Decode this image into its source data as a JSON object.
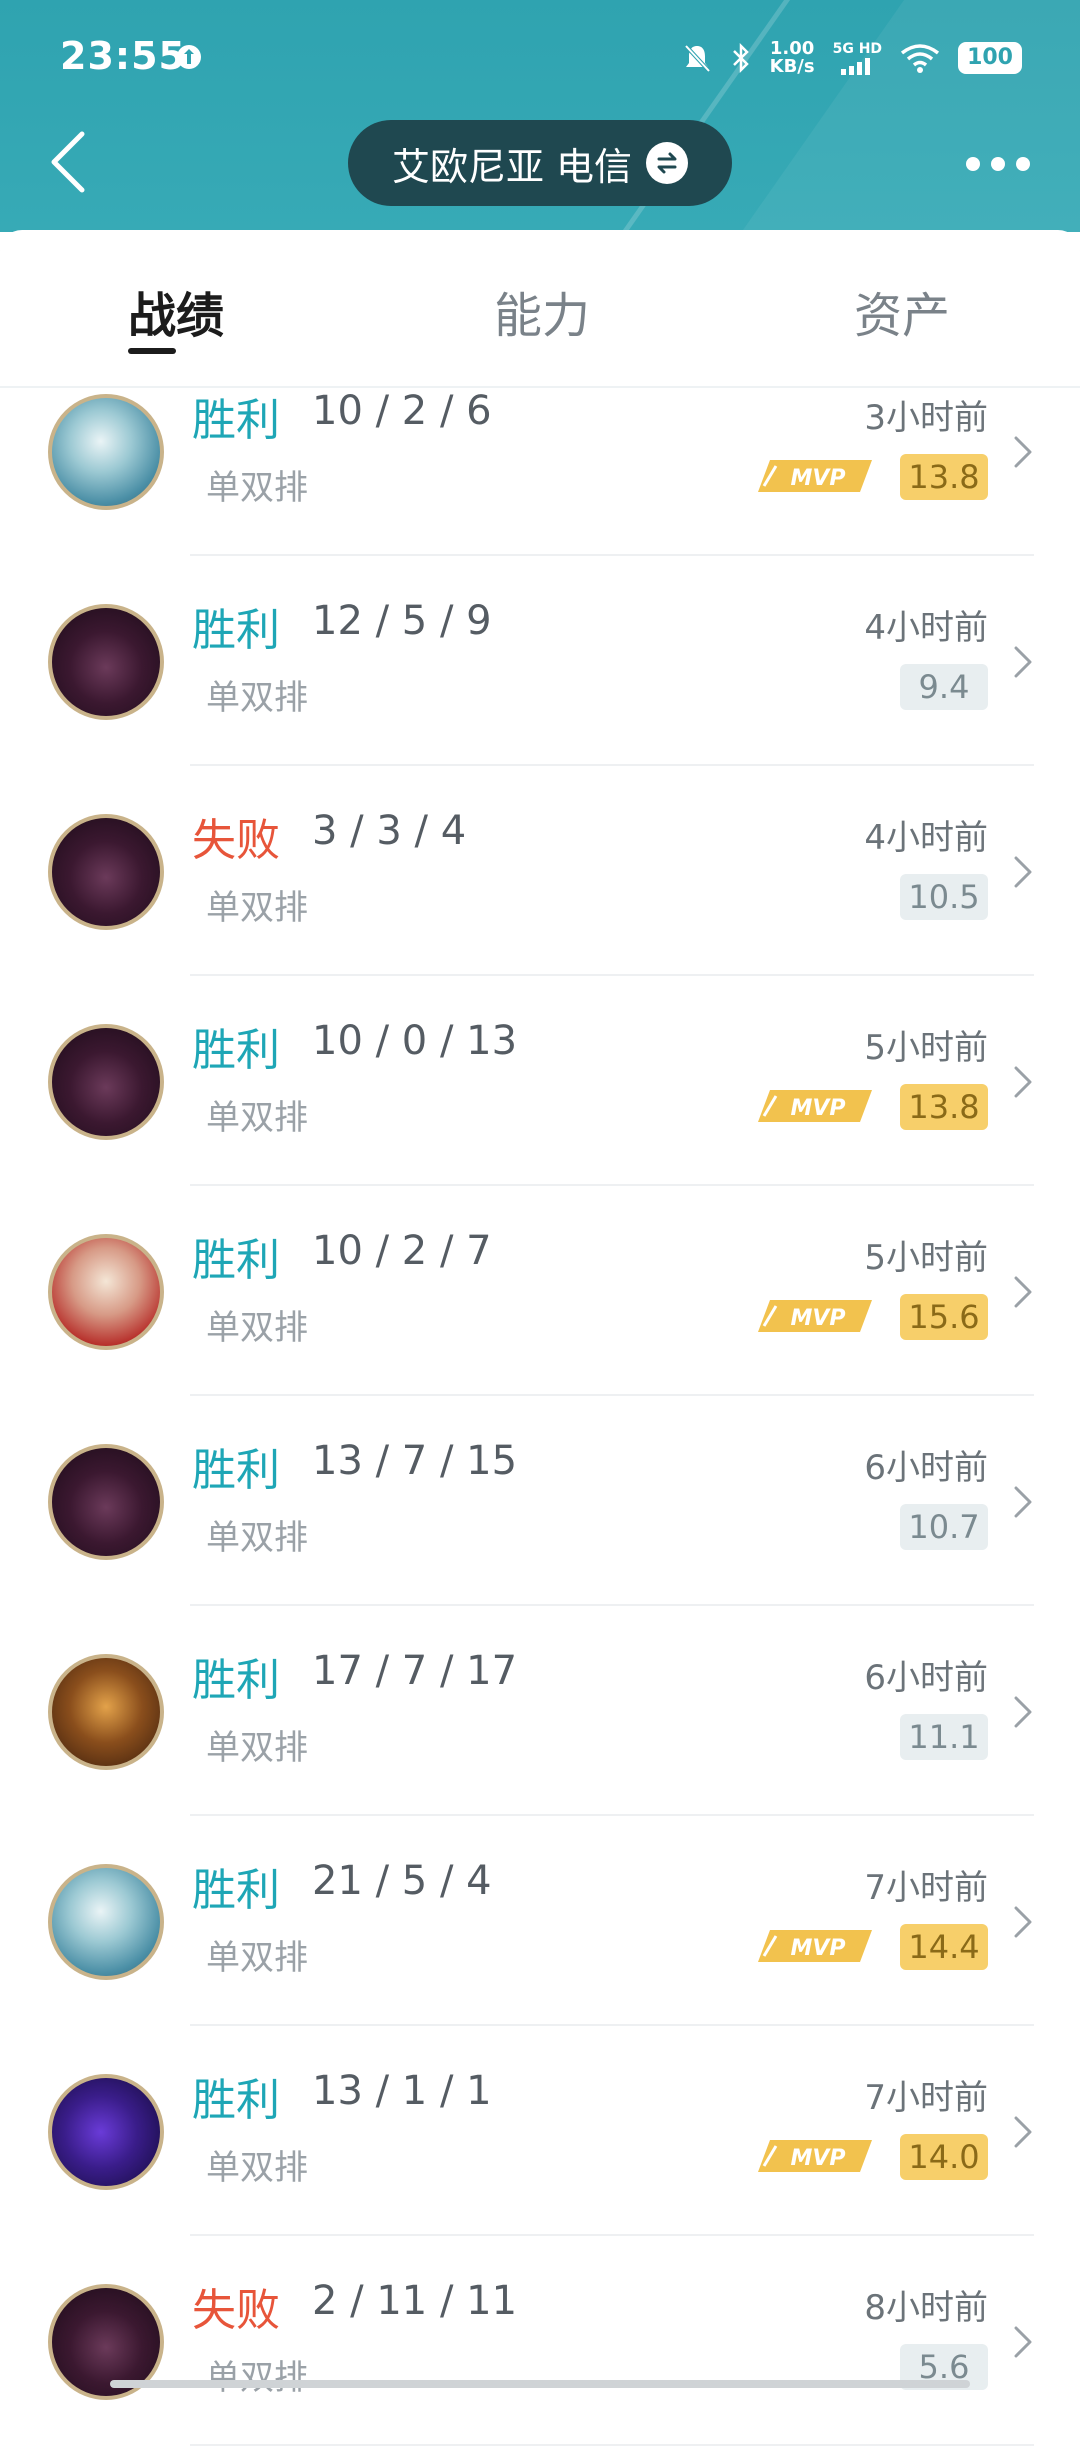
{
  "status_bar": {
    "time": "23:55",
    "net_speed": "1.00",
    "net_unit": "KB/s",
    "network": "5G HD",
    "battery": "100"
  },
  "header": {
    "server": "艾欧尼亚 电信"
  },
  "tabs": [
    {
      "label": "战绩",
      "active": true
    },
    {
      "label": "能力",
      "active": false
    },
    {
      "label": "资产",
      "active": false
    }
  ],
  "matches": [
    {
      "result": "胜利",
      "outcome": "win",
      "kda": "10 / 2 / 6",
      "queue": "单双排",
      "time": "3小时前",
      "mvp": true,
      "score": "13.8",
      "avatar": "a"
    },
    {
      "result": "胜利",
      "outcome": "win",
      "kda": "12 / 5 / 9",
      "queue": "单双排",
      "time": "4小时前",
      "mvp": false,
      "score": "9.4",
      "avatar": "b"
    },
    {
      "result": "失败",
      "outcome": "loss",
      "kda": "3 / 3 / 4",
      "queue": "单双排",
      "time": "4小时前",
      "mvp": false,
      "score": "10.5",
      "avatar": "b"
    },
    {
      "result": "胜利",
      "outcome": "win",
      "kda": "10 / 0 / 13",
      "queue": "单双排",
      "time": "5小时前",
      "mvp": true,
      "score": "13.8",
      "avatar": "b"
    },
    {
      "result": "胜利",
      "outcome": "win",
      "kda": "10 / 2 / 7",
      "queue": "单双排",
      "time": "5小时前",
      "mvp": true,
      "score": "15.6",
      "avatar": "c"
    },
    {
      "result": "胜利",
      "outcome": "win",
      "kda": "13 / 7 / 15",
      "queue": "单双排",
      "time": "6小时前",
      "mvp": false,
      "score": "10.7",
      "avatar": "b"
    },
    {
      "result": "胜利",
      "outcome": "win",
      "kda": "17 / 7 / 17",
      "queue": "单双排",
      "time": "6小时前",
      "mvp": false,
      "score": "11.1",
      "avatar": "d"
    },
    {
      "result": "胜利",
      "outcome": "win",
      "kda": "21 / 5 / 4",
      "queue": "单双排",
      "time": "7小时前",
      "mvp": true,
      "score": "14.4",
      "avatar": "a"
    },
    {
      "result": "胜利",
      "outcome": "win",
      "kda": "13 / 1 / 1",
      "queue": "单双排",
      "time": "7小时前",
      "mvp": true,
      "score": "14.0",
      "avatar": "e"
    },
    {
      "result": "失败",
      "outcome": "loss",
      "kda": "2 / 11 / 11",
      "queue": "单双排",
      "time": "8小时前",
      "mvp": false,
      "score": "5.6",
      "avatar": "b"
    }
  ],
  "mvp_label": "MVP",
  "colors": {
    "header": "#2fa3b0",
    "win": "#1ea6b6",
    "loss": "#e7553a",
    "mvp_score_bg": "#f7cf6a"
  }
}
